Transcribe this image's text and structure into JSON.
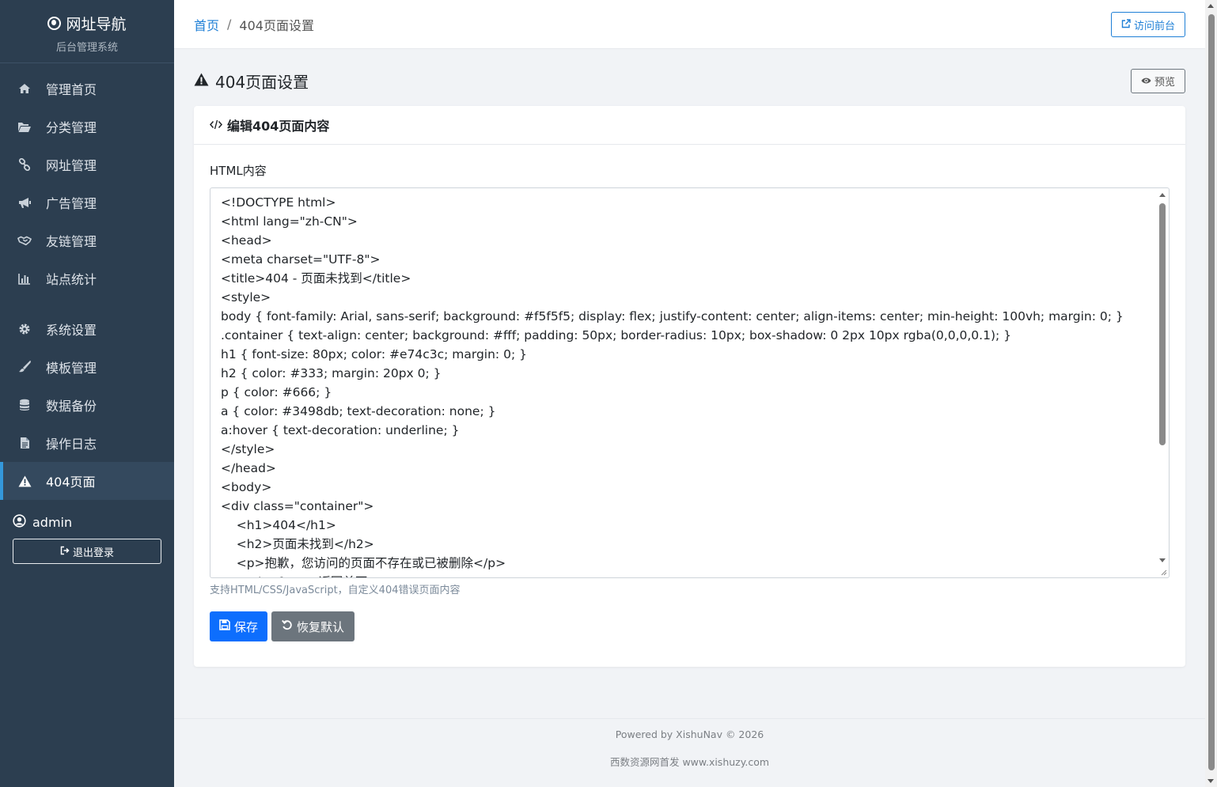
{
  "brand": {
    "title": "网址导航",
    "subtitle": "后台管理系统",
    "icon": "compass-icon"
  },
  "sidebar": {
    "items": [
      {
        "label": "管理首页",
        "icon": "home-icon"
      },
      {
        "label": "分类管理",
        "icon": "folder-open-icon"
      },
      {
        "label": "网址管理",
        "icon": "link-icon"
      },
      {
        "label": "广告管理",
        "icon": "bullhorn-icon"
      },
      {
        "label": "友链管理",
        "icon": "handshake-icon"
      },
      {
        "label": "站点统计",
        "icon": "bar-chart-icon"
      },
      {
        "label": "系统设置",
        "icon": "gear-icon"
      },
      {
        "label": "模板管理",
        "icon": "paintbrush-icon"
      },
      {
        "label": "数据备份",
        "icon": "database-icon"
      },
      {
        "label": "操作日志",
        "icon": "file-text-icon"
      },
      {
        "label": "404页面",
        "icon": "warning-icon",
        "active": true
      }
    ],
    "user": {
      "name": "admin",
      "logout_label": "退出登录"
    }
  },
  "header": {
    "breadcrumb_home": "首页",
    "breadcrumb_sep": "/",
    "breadcrumb_current": "404页面设置",
    "visit_label": "访问前台"
  },
  "main": {
    "title": "404页面设置",
    "preview_label": "预览",
    "card_title": "编辑404页面内容",
    "field_label": "HTML内容",
    "code_lines": [
      "<!DOCTYPE html>",
      "<html lang=\"zh-CN\">",
      "<head>",
      "<meta charset=\"UTF-8\">",
      "<title>404 - 页面未找到</title>",
      "<style>",
      "body { font-family: Arial, sans-serif; background: #f5f5f5; display: flex; justify-content: center; align-items: center; min-height: 100vh; margin: 0; }",
      ".container { text-align: center; background: #fff; padding: 50px; border-radius: 10px; box-shadow: 0 2px 10px rgba(0,0,0,0.1); }",
      "h1 { font-size: 80px; color: #e74c3c; margin: 0; }",
      "h2 { color: #333; margin: 20px 0; }",
      "p { color: #666; }",
      "a { color: #3498db; text-decoration: none; }",
      "a:hover { text-decoration: underline; }",
      "</style>",
      "</head>",
      "<body>",
      "<div class=\"container\">",
      "    <h1>404</h1>",
      "    <h2>页面未找到</h2>",
      "    <p>抱歉，您访问的页面不存在或已被删除</p>",
      "    <a href=\"/\">返回首页</a>"
    ],
    "help_text": "支持HTML/CSS/JavaScript，自定义404错误页面内容",
    "save_label": "保存",
    "reset_label": "恢复默认"
  },
  "footer": {
    "line1": "Powered by XishuNav © 2026",
    "line2": "西数资源网首发 www.xishuzy.com"
  },
  "colors": {
    "sidebar_bg": "#2c3e50",
    "accent": "#3498db",
    "primary": "#0d6efd",
    "secondary": "#6c757d"
  }
}
